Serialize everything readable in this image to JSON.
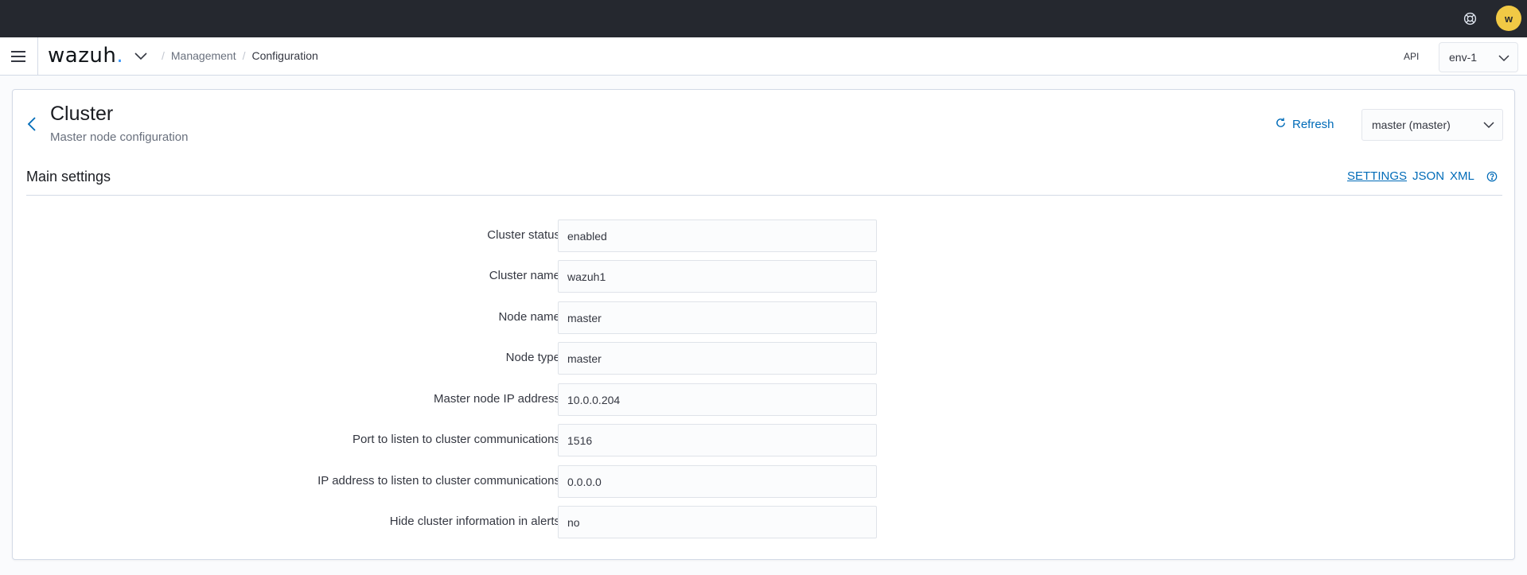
{
  "topbar": {
    "help_icon": "help-lifebuoy-icon",
    "avatar_initial": "w"
  },
  "header": {
    "logo_text": "wazuh",
    "logo_dot": ".",
    "breadcrumb": [
      "Management",
      "Configuration"
    ],
    "api_label": "API",
    "api_env": "env-1"
  },
  "panel": {
    "title": "Cluster",
    "subtitle": "Master node configuration",
    "refresh_label": "Refresh",
    "node_selected": "master (master)",
    "section_title": "Main settings",
    "view_links": [
      "SETTINGS",
      "JSON",
      "XML"
    ],
    "settings": [
      {
        "label": "Cluster status",
        "value": "enabled"
      },
      {
        "label": "Cluster name",
        "value": "wazuh1"
      },
      {
        "label": "Node name",
        "value": "master"
      },
      {
        "label": "Node type",
        "value": "master"
      },
      {
        "label": "Master node IP address",
        "value": "10.0.0.204"
      },
      {
        "label": "Port to listen to cluster communications",
        "value": "1516"
      },
      {
        "label": "IP address to listen to cluster communications",
        "value": "0.0.0.0"
      },
      {
        "label": "Hide cluster information in alerts",
        "value": "no"
      }
    ]
  },
  "colors": {
    "topbar": "#25282f",
    "link": "#006bb8",
    "avatar": "#f1c945",
    "logo_dot": "#3595f9"
  }
}
